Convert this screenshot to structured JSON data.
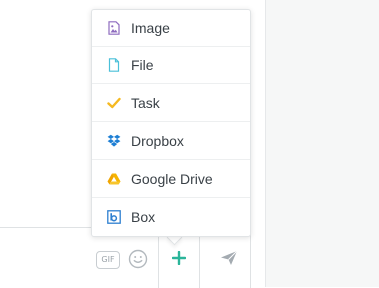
{
  "menu": {
    "items": [
      {
        "label": "Image",
        "icon": "image-icon"
      },
      {
        "label": "File",
        "icon": "file-icon"
      },
      {
        "label": "Task",
        "icon": "checkmark-icon"
      },
      {
        "label": "Dropbox",
        "icon": "dropbox-icon"
      },
      {
        "label": "Google Drive",
        "icon": "google-drive-icon"
      },
      {
        "label": "Box",
        "icon": "box-icon"
      }
    ]
  },
  "composer": {
    "gif_label": "GIF",
    "emoji_icon": "smiley-icon",
    "add_icon": "plus-icon",
    "send_icon": "paper-plane-icon"
  },
  "colors": {
    "image_icon": "#8e6bbf",
    "file_icon": "#4bc0d9",
    "task_icon": "#f5b921",
    "dropbox_icon": "#1e7fd4",
    "google_drive_icon": "#f5b400",
    "box_icon": "#2d7fd0",
    "add_accent": "#2bb59a",
    "send_icon": "#a4abb1"
  }
}
